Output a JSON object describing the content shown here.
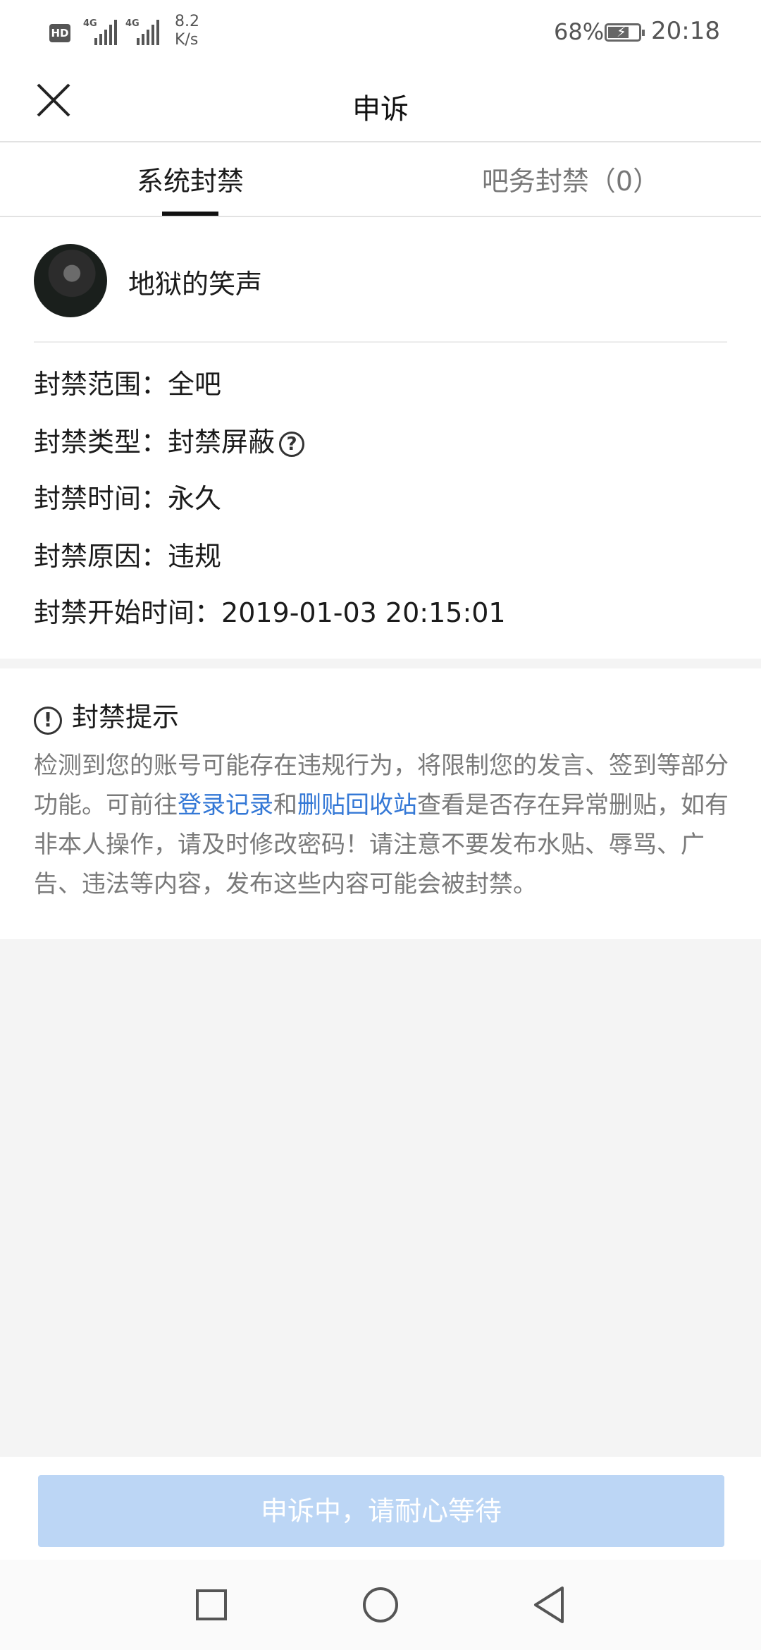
{
  "status_bar": {
    "hd_label": "HD",
    "sim1_label": "4G",
    "sim2_label": "4G",
    "net_speed_value": "8.2",
    "net_speed_unit": "K/s",
    "battery_percent": "68%",
    "battery_level": 0.68,
    "time": "20:18"
  },
  "header": {
    "title": "申诉",
    "close_icon": "close-icon"
  },
  "tabs": [
    {
      "label": "系统封禁",
      "active": true
    },
    {
      "label": "吧务封禁（0）",
      "active": false
    }
  ],
  "user": {
    "name": "地狱的笑声"
  },
  "ban_info": {
    "scope_label": "封禁范围：",
    "scope_value": "全吧",
    "type_label": "封禁类型：",
    "type_value": "封禁屏蔽",
    "time_label": "封禁时间：",
    "time_value": "永久",
    "reason_label": "封禁原因：",
    "reason_value": "违规",
    "start_label": "封禁开始时间：",
    "start_value": "2019-01-03 20:15:01"
  },
  "notice": {
    "title": "封禁提示",
    "text_1": "检测到您的账号可能存在违规行为，将限制您的发言、签到等部分功能。可前往",
    "link_login": "登录记录",
    "text_2": "和",
    "link_recycle": "删贴回收站",
    "text_3": "查看是否存在异常删贴，如有非本人操作，请及时修改密码！请注意不要发布水贴、辱骂、广告、违法等内容，发布这些内容可能会被封禁。"
  },
  "action": {
    "button_label": "申诉中，请耐心等待"
  },
  "colors": {
    "link": "#3478d6",
    "button_disabled": "#bcd6f5",
    "page_background": "#f4f4f4"
  }
}
